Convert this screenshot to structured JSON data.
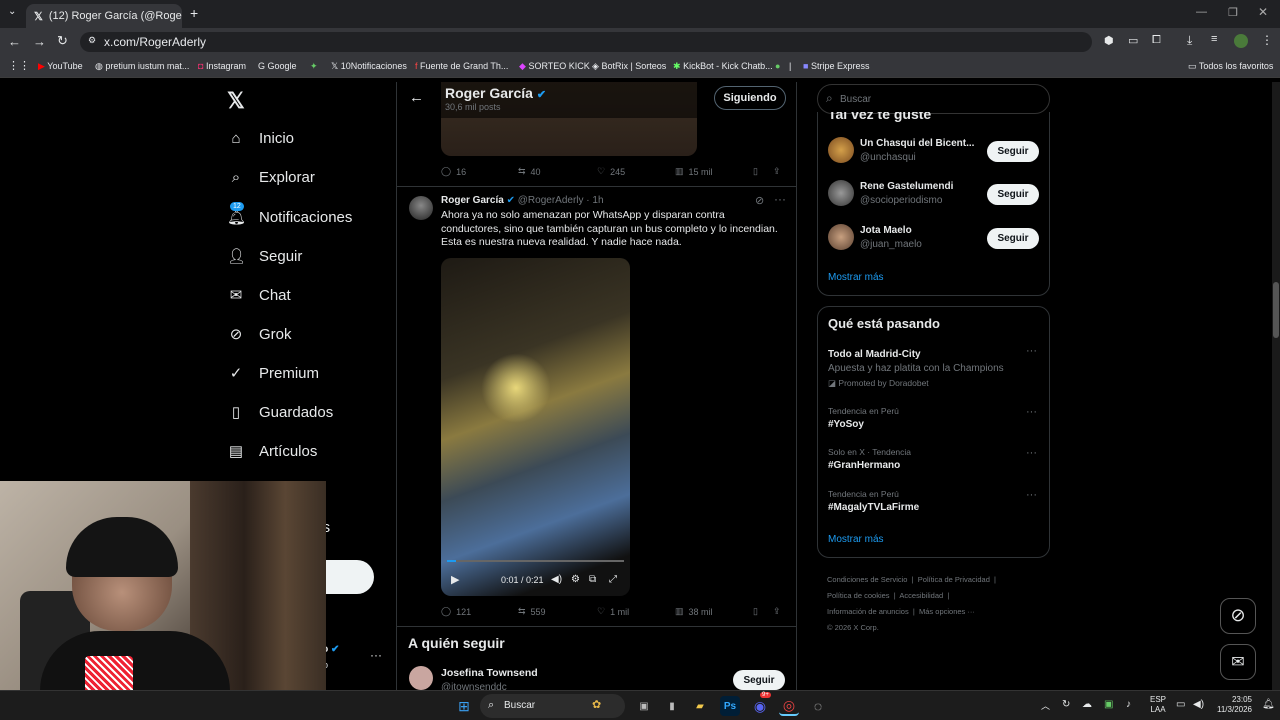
{
  "browser": {
    "tab_title": "(12) Roger García (@RogerAderl",
    "url": "x.com/RogerAderly",
    "bookmarks": [
      "YouTube",
      "pretium iustum mat...",
      "Instagram",
      "Google",
      "",
      "10Notificaciones",
      "Fuente de Grand Th...",
      "SORTEO KICK",
      "BotRix | Sorteos",
      "KickBot - Kick Chatb...",
      "",
      "Stripe Express"
    ],
    "all_bookmarks": "Todos los favoritos"
  },
  "nav": {
    "items": [
      "Inicio",
      "Explorar",
      "Notificaciones",
      "Seguir",
      "Chat",
      "Grok",
      "Premium",
      "Guardados",
      "Artículos"
    ],
    "notif_badge": "12",
    "partial_text": "nes",
    "bottom_user_partial": "no",
    "bottom_handle_partial": "no"
  },
  "header": {
    "name": "Roger García",
    "posts": "30,6 mil posts",
    "follow_button": "Siguiendo"
  },
  "prev_post": {
    "replies": "16",
    "reposts": "40",
    "likes": "245",
    "views": "15 mil"
  },
  "post": {
    "name": "Roger García",
    "handle": "@RogerAderly",
    "time": "· 1h",
    "text": "Ahora ya no solo amenazan por WhatsApp y disparan contra conductores, sino que también capturan un bus completo y lo incendian. Esta es nuestra nueva realidad. Y nadie hace nada.",
    "video_time": "0:01 / 0:21",
    "video_progress": 0.05,
    "replies": "121",
    "reposts": "559",
    "likes": "1 mil",
    "views": "38 mil"
  },
  "who_to_follow": {
    "title": "A quién seguir",
    "user_name": "Josefina Townsend",
    "user_handle": "@jtownsenddc",
    "button": "Seguir"
  },
  "right": {
    "search_placeholder": "Buscar",
    "suggest_title_partial": "Tal vez te guste",
    "suggestions": [
      {
        "name": "Un Chasqui del Bicent...",
        "handle": "@unchasqui",
        "button": "Seguir"
      },
      {
        "name": "Rene Gastelumendi",
        "handle": "@socioperiodismo",
        "button": "Seguir"
      },
      {
        "name": "Jota Maelo",
        "handle": "@juan_maelo",
        "button": "Seguir"
      }
    ],
    "show_more": "Mostrar más",
    "trends_title": "Qué está pasando",
    "trends": [
      {
        "label": "",
        "title": "Todo al Madrid-City",
        "sub": "Apuesta y haz platita con la Champions",
        "promo": "Promoted by Doradobet"
      },
      {
        "label": "Tendencia en Perú",
        "title": "#YoSoy"
      },
      {
        "label": "Solo en X · Tendencia",
        "title": "#GranHermano"
      },
      {
        "label": "Tendencia en Perú",
        "title": "#MagalyTVLaFirme"
      }
    ],
    "trends_more": "Mostrar más",
    "footer": [
      "Condiciones de Servicio",
      "Política de Privacidad",
      "Política de cookies",
      "Accesibilidad",
      "Información de anuncios",
      "Más opciones ···",
      "© 2026 X Corp."
    ]
  },
  "taskbar": {
    "search": "Buscar",
    "lang1": "ESP",
    "lang2": "LAA",
    "time": "23:05",
    "date": "11/3/2026",
    "discord_badge": "9+"
  }
}
